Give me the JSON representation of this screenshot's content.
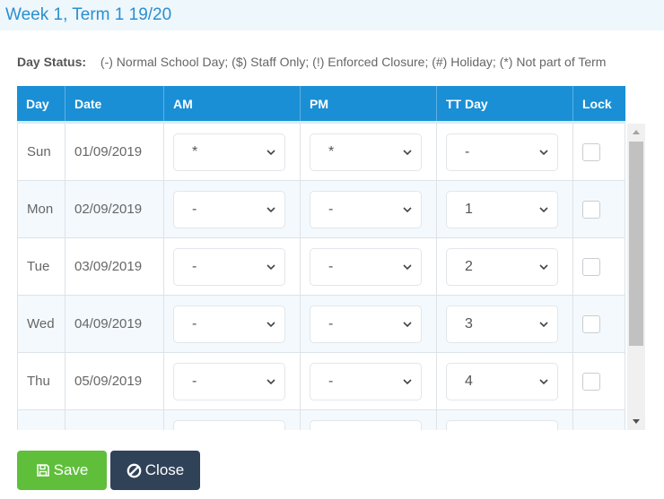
{
  "header": {
    "title": "Week 1, Term 1 19/20"
  },
  "day_status": {
    "label": "Day Status:",
    "legend": "(-) Normal School Day; ($) Staff Only; (!) Enforced Closure; (#) Holiday; (*) Not part of Term"
  },
  "table": {
    "columns": [
      "Day",
      "Date",
      "AM",
      "PM",
      "TT Day",
      "Lock"
    ],
    "rows": [
      {
        "day": "Sun",
        "date": "01/09/2019",
        "am": "*",
        "pm": "*",
        "tt": "-",
        "locked": false
      },
      {
        "day": "Mon",
        "date": "02/09/2019",
        "am": "-",
        "pm": "-",
        "tt": "1",
        "locked": false
      },
      {
        "day": "Tue",
        "date": "03/09/2019",
        "am": "-",
        "pm": "-",
        "tt": "2",
        "locked": false
      },
      {
        "day": "Wed",
        "date": "04/09/2019",
        "am": "-",
        "pm": "-",
        "tt": "3",
        "locked": false
      },
      {
        "day": "Thu",
        "date": "05/09/2019",
        "am": "-",
        "pm": "-",
        "tt": "4",
        "locked": false
      },
      {
        "day": "",
        "date": "",
        "am": "",
        "pm": "",
        "tt": "",
        "locked": false
      }
    ]
  },
  "buttons": {
    "save": "Save",
    "close": "Close"
  },
  "colors": {
    "header_blue": "#1a8fd5",
    "save_green": "#5fbf3b",
    "close_navy": "#2f4257",
    "title_blue": "#2a8fcf"
  }
}
